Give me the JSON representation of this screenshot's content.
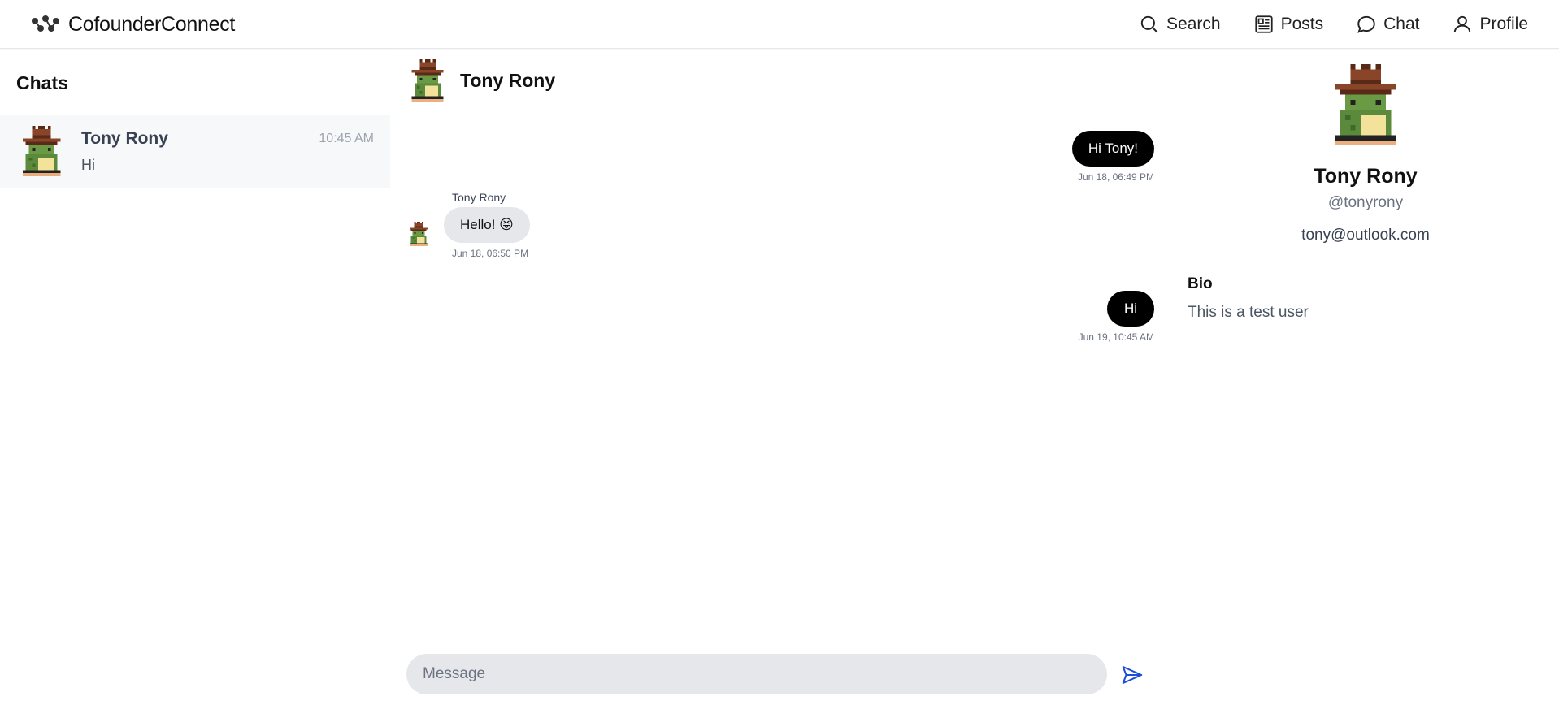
{
  "app": {
    "brand_name": "CofounderConnect",
    "nav": {
      "search": "Search",
      "posts": "Posts",
      "chat": "Chat",
      "profile": "Profile"
    }
  },
  "sidebar": {
    "title": "Chats",
    "chats": [
      {
        "name": "Tony Rony",
        "time": "10:45 AM",
        "preview": "Hi"
      }
    ]
  },
  "conversation": {
    "header_name": "Tony Rony",
    "messages": [
      {
        "direction": "outgoing",
        "text": "Hi Tony!",
        "time": "Jun 18, 06:49 PM"
      },
      {
        "direction": "incoming",
        "sender": "Tony Rony",
        "text": "Hello! 😝",
        "time": "Jun 18, 06:50 PM"
      },
      {
        "direction": "outgoing",
        "text": "Hi",
        "time": "Jun 19, 10:45 AM"
      }
    ],
    "composer_placeholder": "Message"
  },
  "profile": {
    "name": "Tony Rony",
    "handle": "@tonyrony",
    "email": "tony@outlook.com",
    "bio_label": "Bio",
    "bio_text": "This is a test user"
  },
  "colors": {
    "outgoing_bubble": "#000000",
    "incoming_bubble": "#e5e7eb",
    "send_icon": "#1d4ed8",
    "frog_green": "#5b8a3c",
    "hat_brown": "#7a3b22"
  }
}
